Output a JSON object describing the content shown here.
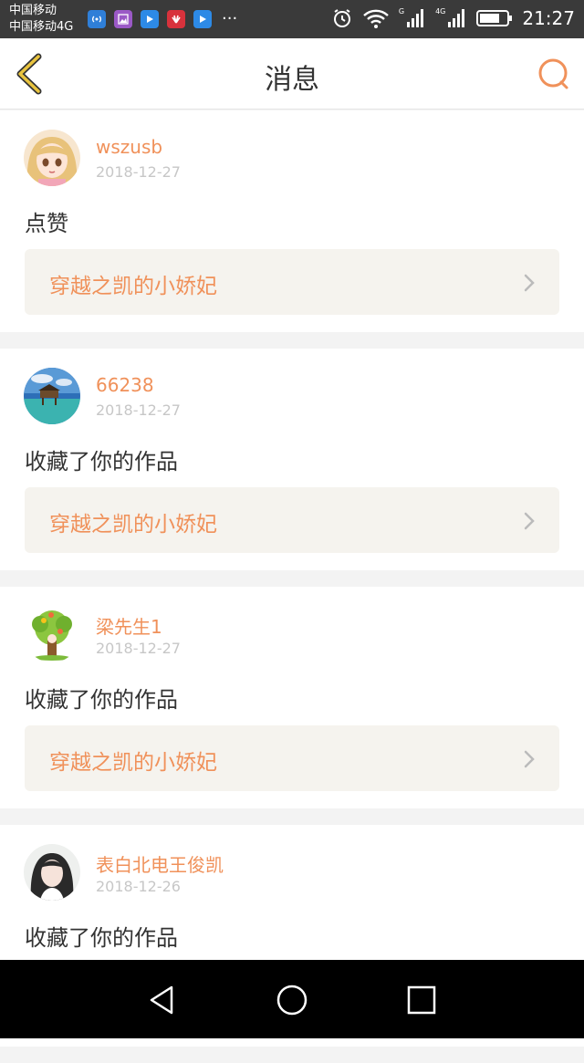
{
  "status_bar": {
    "carrier1": "中国移动",
    "carrier2": "中国移动4G",
    "more": "···",
    "signal_label_1": "G",
    "signal_label_2": "4G",
    "time": "21:27"
  },
  "header": {
    "title": "消息",
    "back_icon": "chevron-left-icon",
    "search_icon": "search-icon"
  },
  "colors": {
    "accent": "#f0915a",
    "back_icon": "#e0b43c",
    "card_link_bg": "#f5f3ee"
  },
  "messages": [
    {
      "user": "wszusb",
      "date": "2018-12-27",
      "action": "点赞",
      "work": "穿越之凯的小娇妃"
    },
    {
      "user": "66238",
      "date": "2018-12-27",
      "action": "收藏了你的作品",
      "work": "穿越之凯的小娇妃"
    },
    {
      "user": "梁先生1",
      "date": "2018-12-27",
      "action": "收藏了你的作品",
      "work": "穿越之凯的小娇妃"
    },
    {
      "user": "表白北电王俊凯",
      "date": "2018-12-26",
      "action": "收藏了你的作品",
      "work": ""
    }
  ]
}
